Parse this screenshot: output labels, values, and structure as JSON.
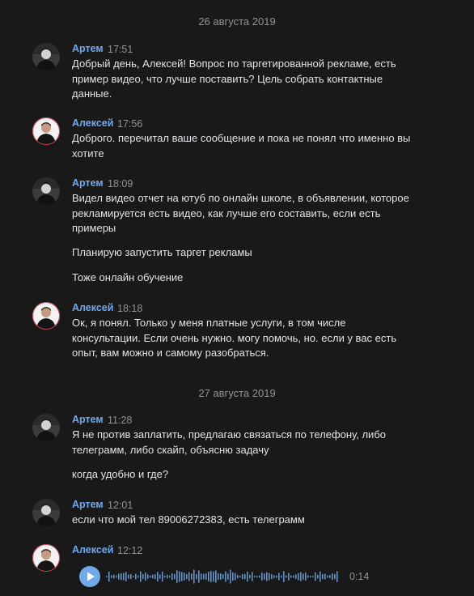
{
  "dates": [
    "26 августа 2019",
    "27 августа 2019"
  ],
  "messages": [
    {
      "author": "Артем",
      "time": "17:51",
      "lines": [
        "Добрый день, Алексей! Вопрос по таргетированной рекламе, есть пример видео, что лучше поставить? Цель собрать контактные данные."
      ]
    },
    {
      "author": "Алексей",
      "time": "17:56",
      "lines": [
        "Доброго. перечитал ваше сообщение и пока не понял что именно вы хотите"
      ]
    },
    {
      "author": "Артем",
      "time": "18:09",
      "lines": [
        "Видел видео отчет на ютуб по онлайн школе, в объявлении, которое рекламируется есть видео, как лучше его составить, если есть примеры",
        "Планирую запустить таргет рекламы",
        "Тоже онлайн обучение"
      ]
    },
    {
      "author": "Алексей",
      "time": "18:18",
      "lines": [
        "Ок, я понял. Только у меня платные услуги, в том числе консультации. Если очень нужно. могу помочь, но. если у вас есть опыт, вам можно и самому разобраться."
      ]
    },
    {
      "author": "Артем",
      "time": "11:28",
      "lines": [
        "Я не против заплатить, предлагаю связаться по телефону, либо телеграмм, либо скайп, объясню задачу",
        "когда удобно и где?"
      ]
    },
    {
      "author": "Артем",
      "time": "12:01",
      "lines": [
        "если что мой тел 89006272383, есть телеграмм"
      ]
    },
    {
      "author": "Алексей",
      "time": "12:12",
      "voice": {
        "duration": "0:14",
        "progress": 0
      }
    }
  ],
  "icons": {
    "play": "play-icon",
    "avatar_artem": "avatar-artem",
    "avatar_aleksey": "avatar-aleksey"
  },
  "colors": {
    "background": "#19191a",
    "author": "#71aaeb",
    "text": "#e1e3e6",
    "muted": "#939393",
    "accent": "#71aaeb"
  }
}
